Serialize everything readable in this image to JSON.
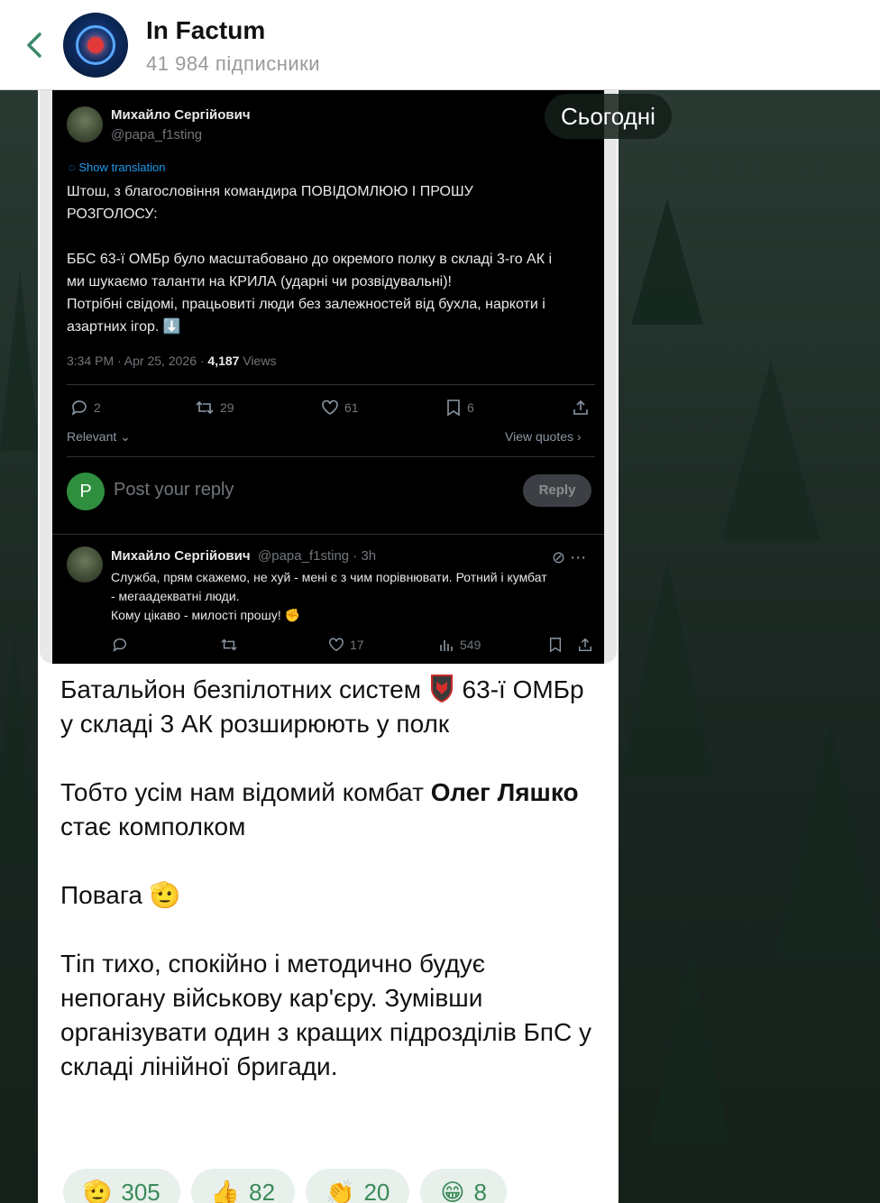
{
  "header": {
    "channel_name": "In Factum",
    "subscribers": "41 984 підписники"
  },
  "date_pill": "Сьогодні",
  "tweet": {
    "author_name": "Михайло Сергійович",
    "author_handle": "@papa_f1sting",
    "show_translation": "Show translation",
    "text_lines": [
      "Штош, з благословіння командира ПОВІДОМЛЮЮ І ПРОШУ",
      "РОЗГОЛОСУ:",
      "",
      "ББС 63-ї ОМБр було масштабовано до окремого полку в складі 3-го АК і",
      "ми шукаємо таланти на КРИЛА (ударні чи розвідувальні)!",
      "Потрібні свідомі, працьовиті люди без залежностей від бухла, наркоти і",
      "азартних ігор. ⬇️"
    ],
    "timestamp": "3:34 PM · Apr 25, 2026 ·",
    "views_count": "4,187",
    "views_label": "Views",
    "replies": "2",
    "reposts": "29",
    "likes": "61",
    "bookmarks": "6",
    "relevant_label": "Relevant",
    "view_quotes_label": "View quotes",
    "reply_avatar_letter": "P",
    "reply_placeholder": "Post your reply",
    "reply_button": "Reply"
  },
  "reply_tweet": {
    "author_name": "Михайло Сергійович",
    "author_meta": "@papa_f1sting · 3h",
    "text_lines": [
      "Служба, прям скажемо, не хуй - мені є з чим порівнювати. Ротний і кумбат",
      "- мегаадекватні люди.",
      "Кому цікаво - милості прошу! ✊"
    ],
    "likes": "17",
    "views": "549"
  },
  "message": {
    "p1": "Батальйон безпілотних систем",
    "p1_after": "63-ї ОМБр у складі 3 АК розширюють у полк",
    "p2_before": "Тобто усім нам відомий комбат ",
    "p2_bold": "Олег Ляшко",
    "p2_after": " стає комполком",
    "p3": "Повага 🫡",
    "p4": "Тіп тихо, спокійно і методично будує непогану військову кар'єру. Зумівши організувати один з кращих підрозділів БпС у складі лінійної бригади."
  },
  "reactions": [
    {
      "emoji": "🫡",
      "count": "305"
    },
    {
      "emoji": "👍",
      "count": "82"
    },
    {
      "emoji": "👏",
      "count": "20"
    },
    {
      "emoji": "😁",
      "count": "8"
    }
  ],
  "colors": {
    "accent": "#3b8a5a",
    "reaction_bg": "#e7f0ea",
    "twitter_blue": "#1d9bf0"
  }
}
